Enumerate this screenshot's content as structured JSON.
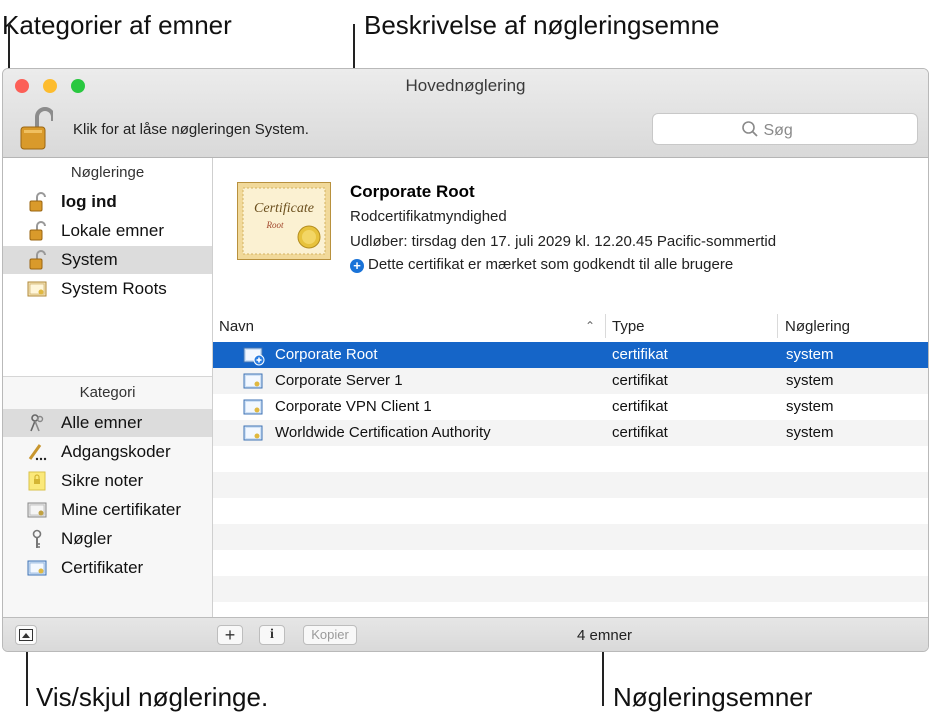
{
  "callouts": {
    "categories": "Kategorier af emner",
    "description": "Beskrivelse af nøgleringsemne",
    "toggle": "Vis/skjul nøgleringe.",
    "items": "Nøgleringsemner"
  },
  "window": {
    "title": "Hovednøglering",
    "lock_text": "Klik for at låse nøgleringen System.",
    "search_placeholder": "Søg"
  },
  "sidebar": {
    "keychains_header": "Nøgleringe",
    "keychains": [
      {
        "label": "log ind",
        "icon": "lock-icon",
        "bold": true
      },
      {
        "label": "Lokale emner",
        "icon": "lock-icon"
      },
      {
        "label": "System",
        "icon": "lock-icon",
        "selected": true
      },
      {
        "label": "System Roots",
        "icon": "certificate-icon"
      }
    ],
    "category_header": "Kategori",
    "categories": [
      {
        "label": "Alle emner",
        "icon": "keys-icon",
        "selected": true
      },
      {
        "label": "Adgangskoder",
        "icon": "pencil-icon"
      },
      {
        "label": "Sikre noter",
        "icon": "note-icon"
      },
      {
        "label": "Mine certifikater",
        "icon": "my-certificate-icon"
      },
      {
        "label": "Nøgler",
        "icon": "key-icon"
      },
      {
        "label": "Certifikater",
        "icon": "certificate-icon"
      }
    ]
  },
  "detail": {
    "name": "Corporate Root",
    "kind": "Rodcertifikatmyndighed",
    "expires": "Udløber: tirsdag den 17. juli 2029 kl. 12.20.45 Pacific-sommertid",
    "trust": "Dette certifikat er mærket som godkendt til alle brugere",
    "cert_title": "Certificate",
    "cert_sub": "Root"
  },
  "table": {
    "headers": {
      "name": "Navn",
      "type": "Type",
      "keychain": "Nøglering"
    },
    "rows": [
      {
        "name": "Corporate Root",
        "type": "certifikat",
        "keychain": "system"
      },
      {
        "name": "Corporate Server 1",
        "type": "certifikat",
        "keychain": "system"
      },
      {
        "name": "Corporate VPN Client 1",
        "type": "certifikat",
        "keychain": "system"
      },
      {
        "name": "Worldwide Certification Authority",
        "type": "certifikat",
        "keychain": "system"
      }
    ]
  },
  "bottom": {
    "add_label": "+",
    "info_label": "i",
    "copy_label": "Kopier",
    "count": "4 emner"
  },
  "colors": {
    "selection": "#1565c8",
    "close": "#fc5f57",
    "minimize": "#fdbc2e",
    "zoom": "#29c840"
  }
}
